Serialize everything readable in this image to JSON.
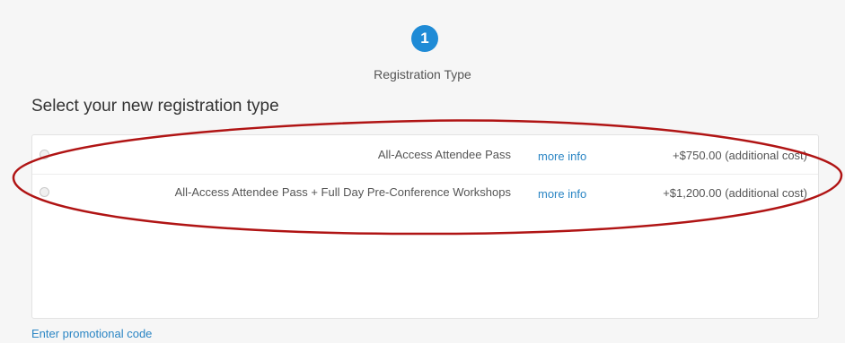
{
  "step": {
    "number": "1",
    "label": "Registration Type"
  },
  "section_title": "Select your new registration type",
  "options": [
    {
      "name": "All-Access Attendee Pass",
      "more_info": "more info",
      "cost": "+$750.00 (additional cost)",
      "selected": false
    },
    {
      "name": "All-Access Attendee Pass + Full Day Pre-Conference Workshops",
      "more_info": "more info",
      "cost": "+$1,200.00 (additional cost)",
      "selected": false
    }
  ],
  "promo_link": "Enter promotional code",
  "colors": {
    "accent": "#1f8bd6",
    "link": "#2a85c4",
    "annotation": "#b01414"
  }
}
